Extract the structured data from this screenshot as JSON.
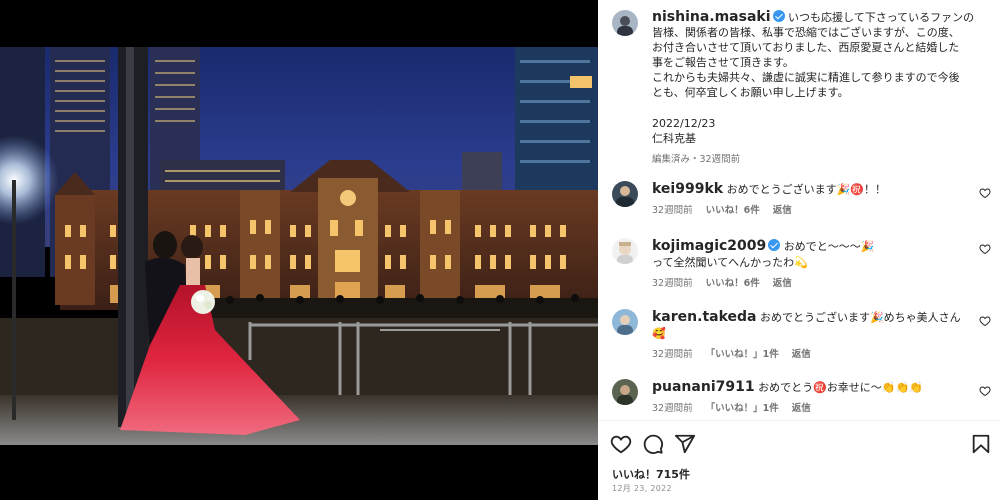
{
  "post": {
    "username": "nishina.masaki",
    "caption_lines": [
      "いつも応援して下さっているファンの",
      "皆様、関係者の皆様、私事で恐縮ではございますが、この度、",
      "お付き合いさせて頂いておりました、西原愛夏さんと結婚した",
      "事をご報告させて頂きます。",
      "これからも夫婦共々、謙虚に誠実に精進して参りますので今後",
      "とも、何卒宜しくお願い申し上げます。"
    ],
    "date_line": "2022/12/23",
    "signature": "仁科克基",
    "edited_meta": "編集済み・32週間前"
  },
  "comments": [
    {
      "username": "kei999kk",
      "verified": false,
      "text": "おめでとうございます🎉㊗️！！",
      "text2": "",
      "time": "32週間前",
      "likes": "いいね！6件",
      "reply": "返信"
    },
    {
      "username": "kojimagic2009",
      "verified": true,
      "text": "おめでと～～～🎉",
      "text2": "って全然聞いてへんかったわ💫",
      "time": "32週間前",
      "likes": "いいね！6件",
      "reply": "返信"
    },
    {
      "username": "karen.takeda",
      "verified": false,
      "text": "おめでとうございます🎉めちゃ美人さん",
      "text2": "🥰",
      "time": "32週間前",
      "likes": "「いいね！」1件",
      "reply": "返信"
    },
    {
      "username": "puanani7911",
      "verified": false,
      "text": "おめでとう㊗️お幸せに〜👏👏👏",
      "text2": "",
      "time": "32週間前",
      "likes": "「いいね！」1件",
      "reply": "返信"
    }
  ],
  "footer": {
    "likes": "いいね！715件",
    "date": "12月 23, 2022"
  },
  "icons": {
    "actions": [
      "heart-icon",
      "comment-icon",
      "share-icon",
      "bookmark-icon"
    ]
  },
  "colors": {
    "verified": "#3897f0",
    "text": "#262626",
    "muted": "#737373",
    "dress": "#d4213a"
  }
}
